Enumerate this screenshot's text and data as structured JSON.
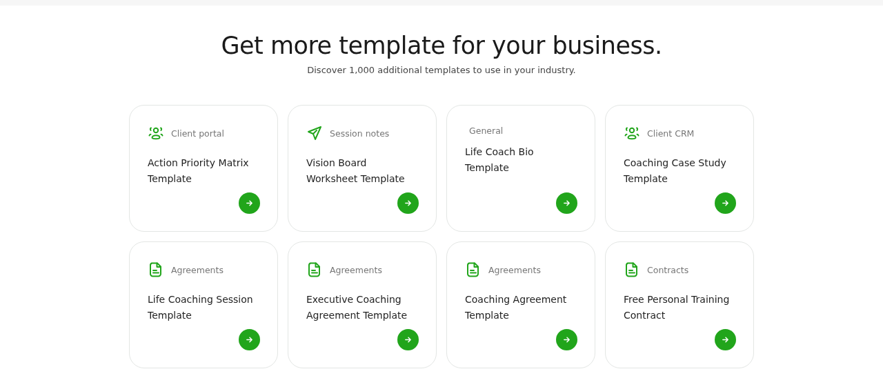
{
  "heading": "Get more template for your business.",
  "subheading": "Discover 1,000 additional templates to use in your industry.",
  "cards": [
    {
      "kind": "people",
      "category": "Client portal",
      "title_lines": [
        "Action Priority Matrix",
        "Template"
      ]
    },
    {
      "kind": "send",
      "category": "Session notes",
      "title_lines": [
        "Vision Board",
        "Worksheet Template"
      ]
    },
    {
      "kind": "plain",
      "category": "General",
      "title_lines": [
        "Life Coach Bio",
        "Template"
      ]
    },
    {
      "kind": "people",
      "category": "Client CRM",
      "title_lines": [
        "Coaching Case Study",
        "Template"
      ]
    },
    {
      "kind": "document",
      "category": "Agreements",
      "title_lines": [
        "Life Coaching Session",
        "Template"
      ]
    },
    {
      "kind": "document",
      "category": "Agreements",
      "title_lines": [
        "Executive Coaching",
        "Agreement Template"
      ]
    },
    {
      "kind": "document",
      "category": "Agreements",
      "title_lines": [
        "Coaching Agreement",
        "Template"
      ]
    },
    {
      "kind": "document",
      "category": "Contracts",
      "title_lines": [
        "Free Personal Training",
        "Contract"
      ]
    }
  ]
}
